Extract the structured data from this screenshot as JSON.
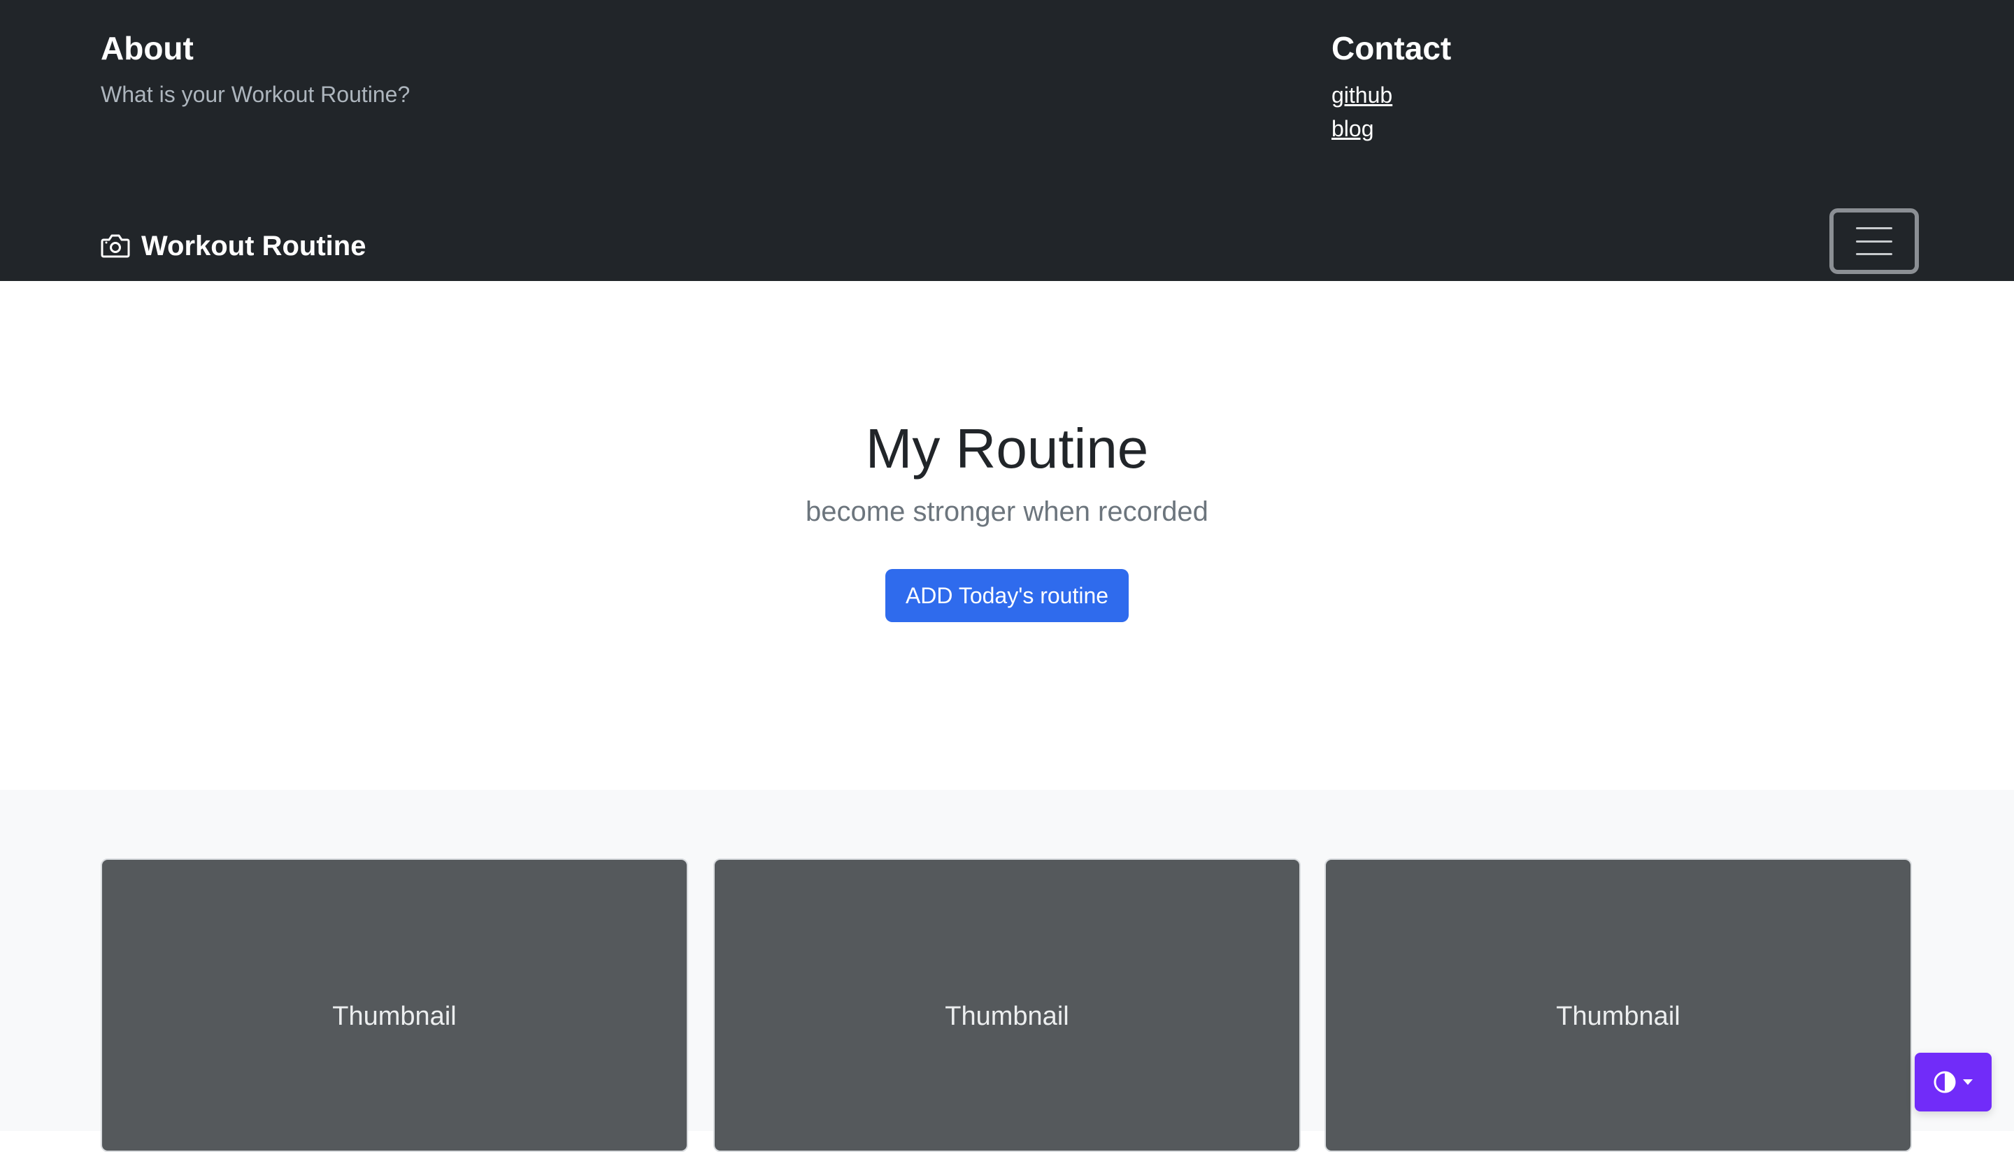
{
  "header": {
    "about": {
      "title": "About",
      "text": "What is your Workout Routine?"
    },
    "contact": {
      "title": "Contact",
      "links": [
        "github",
        "blog"
      ]
    }
  },
  "navbar": {
    "brand": "Workout Routine",
    "brand_icon": "camera-icon",
    "toggler_icon": "hamburger-menu-icon"
  },
  "hero": {
    "title": "My Routine",
    "lead": "become stronger when recorded",
    "button_label": "ADD Today's routine"
  },
  "album": {
    "cards": [
      {
        "label": "Thumbnail"
      },
      {
        "label": "Thumbnail"
      },
      {
        "label": "Thumbnail"
      }
    ]
  },
  "theme_toggle": {
    "icon": "half-circle-contrast-icon",
    "caret_icon": "caret-down-icon"
  },
  "colors": {
    "header_bg": "#212529",
    "primary_button": "#2f6bed",
    "card_bg": "#55595c",
    "album_bg": "#f8f9fa",
    "theme_toggle_bg": "#712cf9"
  }
}
